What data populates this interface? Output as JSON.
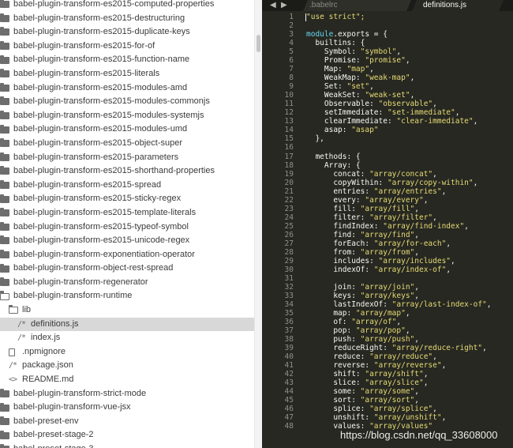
{
  "sidebar": {
    "items": [
      {
        "label": "babel-plugin-transform-es2015-computed-properties",
        "type": "folder",
        "depth": 0
      },
      {
        "label": "babel-plugin-transform-es2015-destructuring",
        "type": "folder",
        "depth": 0
      },
      {
        "label": "babel-plugin-transform-es2015-duplicate-keys",
        "type": "folder",
        "depth": 0
      },
      {
        "label": "babel-plugin-transform-es2015-for-of",
        "type": "folder",
        "depth": 0
      },
      {
        "label": "babel-plugin-transform-es2015-function-name",
        "type": "folder",
        "depth": 0
      },
      {
        "label": "babel-plugin-transform-es2015-literals",
        "type": "folder",
        "depth": 0
      },
      {
        "label": "babel-plugin-transform-es2015-modules-amd",
        "type": "folder",
        "depth": 0
      },
      {
        "label": "babel-plugin-transform-es2015-modules-commonjs",
        "type": "folder",
        "depth": 0
      },
      {
        "label": "babel-plugin-transform-es2015-modules-systemjs",
        "type": "folder",
        "depth": 0
      },
      {
        "label": "babel-plugin-transform-es2015-modules-umd",
        "type": "folder",
        "depth": 0
      },
      {
        "label": "babel-plugin-transform-es2015-object-super",
        "type": "folder",
        "depth": 0
      },
      {
        "label": "babel-plugin-transform-es2015-parameters",
        "type": "folder",
        "depth": 0
      },
      {
        "label": "babel-plugin-transform-es2015-shorthand-properties",
        "type": "folder",
        "depth": 0
      },
      {
        "label": "babel-plugin-transform-es2015-spread",
        "type": "folder",
        "depth": 0
      },
      {
        "label": "babel-plugin-transform-es2015-sticky-regex",
        "type": "folder",
        "depth": 0
      },
      {
        "label": "babel-plugin-transform-es2015-template-literals",
        "type": "folder",
        "depth": 0
      },
      {
        "label": "babel-plugin-transform-es2015-typeof-symbol",
        "type": "folder",
        "depth": 0
      },
      {
        "label": "babel-plugin-transform-es2015-unicode-regex",
        "type": "folder",
        "depth": 0
      },
      {
        "label": "babel-plugin-transform-exponentiation-operator",
        "type": "folder",
        "depth": 0
      },
      {
        "label": "babel-plugin-transform-object-rest-spread",
        "type": "folder",
        "depth": 0
      },
      {
        "label": "babel-plugin-transform-regenerator",
        "type": "folder",
        "depth": 0
      },
      {
        "label": "babel-plugin-transform-runtime",
        "type": "folder-open",
        "depth": 0
      },
      {
        "label": "lib",
        "type": "folder-open",
        "depth": 1
      },
      {
        "label": "definitions.js",
        "type": "js",
        "depth": 2,
        "selected": true
      },
      {
        "label": "index.js",
        "type": "js",
        "depth": 2
      },
      {
        "label": ".npmignore",
        "type": "doc",
        "depth": 1
      },
      {
        "label": "package.json",
        "type": "js",
        "depth": 1
      },
      {
        "label": "README.md",
        "type": "md",
        "depth": 1
      },
      {
        "label": "babel-plugin-transform-strict-mode",
        "type": "folder",
        "depth": 0
      },
      {
        "label": "babel-plugin-transform-vue-jsx",
        "type": "folder",
        "depth": 0
      },
      {
        "label": "babel-preset-env",
        "type": "folder",
        "depth": 0
      },
      {
        "label": "babel-preset-stage-2",
        "type": "folder",
        "depth": 0
      },
      {
        "label": "babel-preset-stage-3",
        "type": "folder",
        "depth": 0
      }
    ],
    "icons": {
      "js": "/*",
      "md": "<>",
      "doc": "file-icon",
      "folder": "folder-icon",
      "folder-open": "folder-open-icon"
    }
  },
  "editor": {
    "nav": {
      "back": "◀",
      "forward": "▶"
    },
    "tabs": [
      {
        "label": ".babelrc",
        "active": false
      },
      {
        "label": "definitions.js",
        "active": true
      }
    ],
    "colors": {
      "background": "#272822",
      "string": "#e6db74",
      "keyword": "#66d9ef",
      "text": "#f8f8f2",
      "gutter": "#90908a"
    },
    "line_numbers": [
      "1",
      "2",
      "3",
      "4",
      "5",
      "6",
      "7",
      "8",
      "9",
      "10",
      "11",
      "12",
      "13",
      "14",
      "15",
      "16",
      "17",
      "18",
      "19",
      "20",
      "21",
      "22",
      "23",
      "24",
      "25",
      "26",
      "27",
      "28",
      "29",
      "30",
      "31",
      "32",
      "33",
      "34",
      "35",
      "36",
      "37",
      "38",
      "39",
      "40",
      "41",
      "42",
      "43",
      "44",
      "45",
      "46",
      "47",
      "48"
    ],
    "lines": [
      [
        [
          "\"use strict\";",
          "s"
        ]
      ],
      [
        [
          "",
          ""
        ]
      ],
      [
        [
          "module",
          "k"
        ],
        [
          ".exports = {",
          ""
        ]
      ],
      [
        [
          "  builtins: {",
          ""
        ]
      ],
      [
        [
          "    Symbol: ",
          ""
        ],
        [
          "\"symbol\"",
          "s"
        ],
        [
          ",",
          ""
        ]
      ],
      [
        [
          "    Promise: ",
          ""
        ],
        [
          "\"promise\"",
          "s"
        ],
        [
          ",",
          ""
        ]
      ],
      [
        [
          "    Map: ",
          ""
        ],
        [
          "\"map\"",
          "s"
        ],
        [
          ",",
          ""
        ]
      ],
      [
        [
          "    WeakMap: ",
          ""
        ],
        [
          "\"weak-map\"",
          "s"
        ],
        [
          ",",
          ""
        ]
      ],
      [
        [
          "    Set: ",
          ""
        ],
        [
          "\"set\"",
          "s"
        ],
        [
          ",",
          ""
        ]
      ],
      [
        [
          "    WeakSet: ",
          ""
        ],
        [
          "\"weak-set\"",
          "s"
        ],
        [
          ",",
          ""
        ]
      ],
      [
        [
          "    Observable: ",
          ""
        ],
        [
          "\"observable\"",
          "s"
        ],
        [
          ",",
          ""
        ]
      ],
      [
        [
          "    setImmediate: ",
          ""
        ],
        [
          "\"set-immediate\"",
          "s"
        ],
        [
          ",",
          ""
        ]
      ],
      [
        [
          "    clearImmediate: ",
          ""
        ],
        [
          "\"clear-immediate\"",
          "s"
        ],
        [
          ",",
          ""
        ]
      ],
      [
        [
          "    asap: ",
          ""
        ],
        [
          "\"asap\"",
          "s"
        ]
      ],
      [
        [
          "  },",
          ""
        ]
      ],
      [
        [
          "",
          ""
        ]
      ],
      [
        [
          "  methods: {",
          ""
        ]
      ],
      [
        [
          "    Array: {",
          ""
        ]
      ],
      [
        [
          "      concat: ",
          ""
        ],
        [
          "\"array/concat\"",
          "s"
        ],
        [
          ",",
          ""
        ]
      ],
      [
        [
          "      copyWithin: ",
          ""
        ],
        [
          "\"array/copy-within\"",
          "s"
        ],
        [
          ",",
          ""
        ]
      ],
      [
        [
          "      entries: ",
          ""
        ],
        [
          "\"array/entries\"",
          "s"
        ],
        [
          ",",
          ""
        ]
      ],
      [
        [
          "      every: ",
          ""
        ],
        [
          "\"array/every\"",
          "s"
        ],
        [
          ",",
          ""
        ]
      ],
      [
        [
          "      fill: ",
          ""
        ],
        [
          "\"array/fill\"",
          "s"
        ],
        [
          ",",
          ""
        ]
      ],
      [
        [
          "      filter: ",
          ""
        ],
        [
          "\"array/filter\"",
          "s"
        ],
        [
          ",",
          ""
        ]
      ],
      [
        [
          "      findIndex: ",
          ""
        ],
        [
          "\"array/find-index\"",
          "s"
        ],
        [
          ",",
          ""
        ]
      ],
      [
        [
          "      find: ",
          ""
        ],
        [
          "\"array/find\"",
          "s"
        ],
        [
          ",",
          ""
        ]
      ],
      [
        [
          "      forEach: ",
          ""
        ],
        [
          "\"array/for-each\"",
          "s"
        ],
        [
          ",",
          ""
        ]
      ],
      [
        [
          "      from: ",
          ""
        ],
        [
          "\"array/from\"",
          "s"
        ],
        [
          ",",
          ""
        ]
      ],
      [
        [
          "      includes: ",
          ""
        ],
        [
          "\"array/includes\"",
          "s"
        ],
        [
          ",",
          ""
        ]
      ],
      [
        [
          "      indexOf: ",
          ""
        ],
        [
          "\"array/index-of\"",
          "s"
        ],
        [
          ",",
          ""
        ]
      ],
      [
        [
          "",
          ""
        ]
      ],
      [
        [
          "      join: ",
          ""
        ],
        [
          "\"array/join\"",
          "s"
        ],
        [
          ",",
          ""
        ]
      ],
      [
        [
          "      keys: ",
          ""
        ],
        [
          "\"array/keys\"",
          "s"
        ],
        [
          ",",
          ""
        ]
      ],
      [
        [
          "      lastIndexOf: ",
          ""
        ],
        [
          "\"array/last-index-of\"",
          "s"
        ],
        [
          ",",
          ""
        ]
      ],
      [
        [
          "      map: ",
          ""
        ],
        [
          "\"array/map\"",
          "s"
        ],
        [
          ",",
          ""
        ]
      ],
      [
        [
          "      of: ",
          ""
        ],
        [
          "\"array/of\"",
          "s"
        ],
        [
          ",",
          ""
        ]
      ],
      [
        [
          "      pop: ",
          ""
        ],
        [
          "\"array/pop\"",
          "s"
        ],
        [
          ",",
          ""
        ]
      ],
      [
        [
          "      push: ",
          ""
        ],
        [
          "\"array/push\"",
          "s"
        ],
        [
          ",",
          ""
        ]
      ],
      [
        [
          "      reduceRight: ",
          ""
        ],
        [
          "\"array/reduce-right\"",
          "s"
        ],
        [
          ",",
          ""
        ]
      ],
      [
        [
          "      reduce: ",
          ""
        ],
        [
          "\"array/reduce\"",
          "s"
        ],
        [
          ",",
          ""
        ]
      ],
      [
        [
          "      reverse: ",
          ""
        ],
        [
          "\"array/reverse\"",
          "s"
        ],
        [
          ",",
          ""
        ]
      ],
      [
        [
          "      shift: ",
          ""
        ],
        [
          "\"array/shift\"",
          "s"
        ],
        [
          ",",
          ""
        ]
      ],
      [
        [
          "      slice: ",
          ""
        ],
        [
          "\"array/slice\"",
          "s"
        ],
        [
          ",",
          ""
        ]
      ],
      [
        [
          "      some: ",
          ""
        ],
        [
          "\"array/some\"",
          "s"
        ],
        [
          ",",
          ""
        ]
      ],
      [
        [
          "      sort: ",
          ""
        ],
        [
          "\"array/sort\"",
          "s"
        ],
        [
          ",",
          ""
        ]
      ],
      [
        [
          "      splice: ",
          ""
        ],
        [
          "\"array/splice\"",
          "s"
        ],
        [
          ",",
          ""
        ]
      ],
      [
        [
          "      unshift: ",
          ""
        ],
        [
          "\"array/unshift\"",
          "s"
        ],
        [
          ",",
          ""
        ]
      ],
      [
        [
          "      values: ",
          ""
        ],
        [
          "\"array/values\"",
          "s"
        ]
      ]
    ]
  },
  "watermark": "https://blog.csdn.net/qq_33608000"
}
